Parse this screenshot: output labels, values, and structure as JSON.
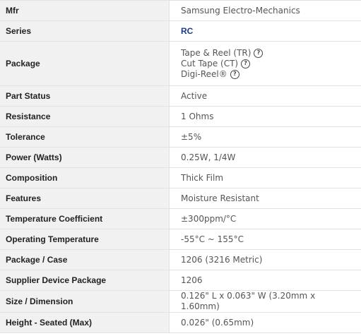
{
  "rows": [
    {
      "label": "Mfr",
      "value": "Samsung Electro-Mechanics"
    },
    {
      "label": "Series",
      "value": "RC"
    },
    {
      "label": "Package",
      "options": [
        {
          "text": "Tape & Reel (TR)",
          "icon": "question-circle-icon"
        },
        {
          "text": "Cut Tape (CT)",
          "icon": "question-circle-icon"
        },
        {
          "text": "Digi-Reel®",
          "icon": "question-circle-icon"
        }
      ]
    },
    {
      "label": "Part Status",
      "value": "Active"
    },
    {
      "label": "Resistance",
      "value": "1 Ohms"
    },
    {
      "label": "Tolerance",
      "value": "±5%"
    },
    {
      "label": "Power (Watts)",
      "value": "0.25W, 1/4W"
    },
    {
      "label": "Composition",
      "value": "Thick Film"
    },
    {
      "label": "Features",
      "value": "Moisture Resistant"
    },
    {
      "label": "Temperature Coefficient",
      "value": "±300ppm/°C"
    },
    {
      "label": "Operating Temperature",
      "value": "-55°C ~ 155°C"
    },
    {
      "label": "Package / Case",
      "value": "1206 (3216 Metric)"
    },
    {
      "label": "Supplier Device Package",
      "value": "1206"
    },
    {
      "label": "Size / Dimension",
      "value": "0.126\" L x 0.063\" W (3.20mm x 1.60mm)"
    },
    {
      "label": "Height - Seated (Max)",
      "value": "0.026\" (0.65mm)"
    }
  ],
  "help_glyph": "?",
  "colors": {
    "label_bg": "#f1f1f1",
    "link": "#1a3c8f",
    "border": "#e2e2e2"
  }
}
